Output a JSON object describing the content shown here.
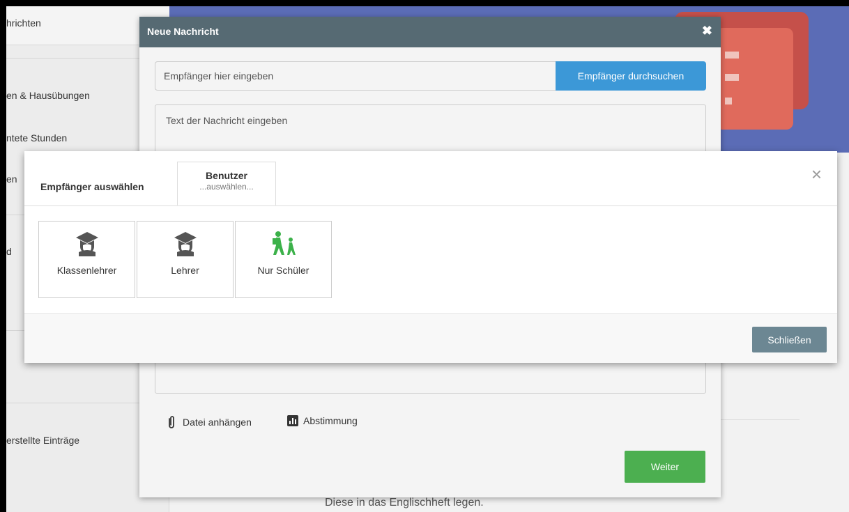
{
  "sidebar": {
    "header": "hrichten",
    "items": [
      {
        "label": "en & Hausübungen"
      },
      {
        "label": "ntete Stunden"
      },
      {
        "label": "en"
      },
      {
        "label": "d"
      },
      {
        "label": "erstellte Einträge"
      }
    ]
  },
  "background": {
    "text": "Diese in das Englischheft legen."
  },
  "new_message": {
    "title": "Neue Nachricht",
    "close_icon": "times-icon",
    "recipient_placeholder": "Empfänger hier eingeben",
    "search_button": "Empfänger durchsuchen",
    "message_placeholder": "Text der Nachricht eingeben",
    "attach_label": "Datei anhängen",
    "poll_label": "Abstimmung",
    "next_button": "Weiter",
    "colors": {
      "header": "#566a73",
      "search": "#3c98d7",
      "next": "#4caf50"
    }
  },
  "recipient_dialog": {
    "title": "Empfänger auswählen",
    "tab": {
      "title": "Benutzer",
      "subtitle": "...auswählen..."
    },
    "close_glyph": "×",
    "options": [
      {
        "label": "Klassenlehrer",
        "icon": "graduate-icon"
      },
      {
        "label": "Lehrer",
        "icon": "graduate-icon"
      },
      {
        "label": "Nur Schüler",
        "icon": "students-walking-icon"
      }
    ],
    "close_button": "Schließen"
  }
}
